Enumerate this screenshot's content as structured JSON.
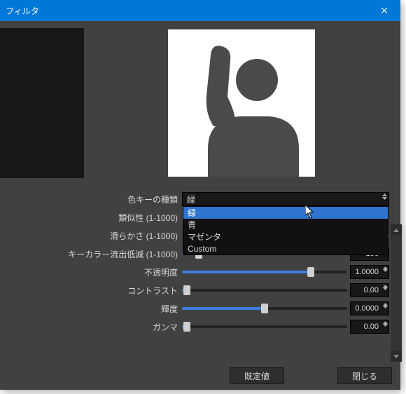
{
  "window": {
    "title": "フィルタ"
  },
  "combo": {
    "label": "色キーの種類",
    "value": "緑",
    "options": [
      "緑",
      "青",
      "マゼンタ",
      "Custom"
    ],
    "selected_index": 0
  },
  "sliders": {
    "similarity": {
      "label": "類似性 (1-1000)"
    },
    "smoothness": {
      "label": "滑らかさ (1-1000)"
    },
    "spill": {
      "label": "キーカラー流出低減 (1-1000)",
      "value": "100",
      "pct": 10
    },
    "opacity": {
      "label": "不透明度",
      "value": "1.0000",
      "pct": 78
    },
    "contrast": {
      "label": "コントラスト",
      "value": "0.00",
      "pct": 3
    },
    "brightness": {
      "label": "輝度",
      "value": "0.0000",
      "pct": 50
    },
    "gamma": {
      "label": "ガンマ",
      "value": "0.00",
      "pct": 3
    }
  },
  "buttons": {
    "default": "既定値",
    "close": "閉じる"
  },
  "colors": {
    "accent": "#0078d7",
    "slider": "#3a7ce0",
    "bg": "#414141"
  }
}
